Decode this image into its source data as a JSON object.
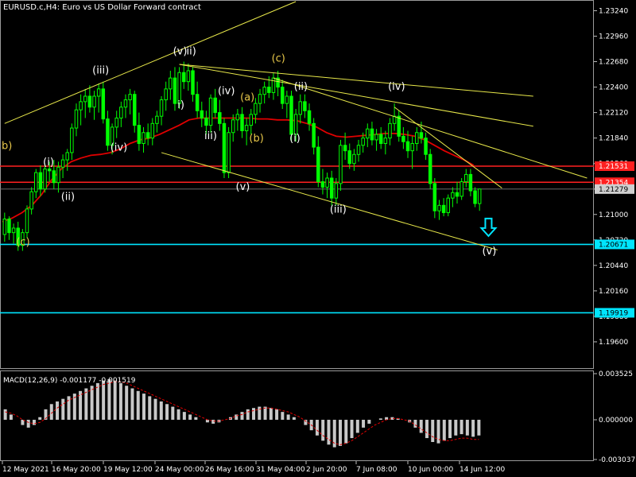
{
  "header": {
    "title": "EURUSD.c,H4:  Euro vs US Dollar Forward contract"
  },
  "chart_data": {
    "type": "candlestick",
    "main_panel": {
      "symbol": "EURUSD.c",
      "timeframe": "H4",
      "ylim": [
        1.1932,
        1.2334
      ],
      "y_ticks": [
        "1.23240",
        "1.22960",
        "1.22680",
        "1.22400",
        "1.22120",
        "1.21840",
        "1.21560",
        "1.21279",
        "1.21000",
        "1.20720",
        "1.20440",
        "1.20160",
        "1.19880",
        "1.19600"
      ],
      "y_tick_values": [
        1.2324,
        1.2296,
        1.2268,
        1.224,
        1.2212,
        1.2184,
        1.2156,
        1.21279,
        1.21,
        1.2072,
        1.2044,
        1.2016,
        1.1988,
        1.196
      ],
      "current_price": 1.21279,
      "moving_average_color": "#e00000",
      "candle_color": "#00ff00",
      "horizontal_levels": [
        {
          "value": 1.21531,
          "label": "1.21531",
          "color": "#ff2020"
        },
        {
          "value": 1.21354,
          "label": "1.21354",
          "color": "#ff2020"
        },
        {
          "value": 1.20671,
          "label": "1.20671",
          "color": "#00e5ff"
        },
        {
          "value": 1.19919,
          "label": "1.19919",
          "color": "#00e5ff"
        }
      ],
      "wave_labels": [
        {
          "text": "b)",
          "x": 0,
          "y": 1.2172,
          "color": "#e8c84a"
        },
        {
          "text": "(i)",
          "x": 10,
          "y": 1.2154,
          "color": "#ffffff"
        },
        {
          "text": "(ii)",
          "x": 14,
          "y": 1.2116,
          "color": "#ffffff"
        },
        {
          "text": "(c)",
          "x": 4,
          "y": 1.2066,
          "color": "#e8c84a"
        },
        {
          "text": "(iii)",
          "x": 21,
          "y": 1.2255,
          "color": "#ffffff"
        },
        {
          "text": "(iv)",
          "x": 25,
          "y": 1.217,
          "color": "#ffffff"
        },
        {
          "text": "(v)",
          "x": 39,
          "y": 1.2276,
          "color": "#ffffff"
        },
        {
          "text": "ii)",
          "x": 42,
          "y": 1.2276,
          "color": "#ffffff"
        },
        {
          "text": "i)",
          "x": 40,
          "y": 1.2217,
          "color": "#ffffff"
        },
        {
          "text": "(iv)",
          "x": 49,
          "y": 1.2232,
          "color": "#ffffff"
        },
        {
          "text": "iii)",
          "x": 46,
          "y": 1.2183,
          "color": "#ffffff"
        },
        {
          "text": "(a)",
          "x": 54,
          "y": 1.2225,
          "color": "#e8c84a"
        },
        {
          "text": "(b)",
          "x": 56,
          "y": 1.218,
          "color": "#e8c84a"
        },
        {
          "text": "(v)",
          "x": 53,
          "y": 1.2127,
          "color": "#ffffff"
        },
        {
          "text": "(c)",
          "x": 61,
          "y": 1.2268,
          "color": "#e8c84a"
        },
        {
          "text": "(ii)",
          "x": 66,
          "y": 1.2237,
          "color": "#ffffff"
        },
        {
          "text": "(i)",
          "x": 65,
          "y": 1.218,
          "color": "#ffffff"
        },
        {
          "text": "(iii)",
          "x": 74,
          "y": 1.2102,
          "color": "#ffffff"
        },
        {
          "text": "(iv)",
          "x": 87,
          "y": 1.2237,
          "color": "#ffffff"
        },
        {
          "text": "(v)",
          "x": 108,
          "y": 1.2056,
          "color": "#ffffff"
        }
      ],
      "trend_lines": [
        {
          "from": [
            0,
            1.22
          ],
          "to": [
            65,
            1.2334
          ],
          "color": "#e8e84a"
        },
        {
          "from": [
            35,
            1.2168
          ],
          "to": [
            110,
            1.2061
          ],
          "color": "#e8e84a"
        },
        {
          "from": [
            39,
            1.2265
          ],
          "to": [
            118,
            1.223
          ],
          "color": "#e8e84a"
        },
        {
          "from": [
            39,
            1.2265
          ],
          "to": [
            118,
            1.2197
          ],
          "color": "#e8e84a"
        },
        {
          "from": [
            60,
            1.225
          ],
          "to": [
            130,
            1.214
          ],
          "color": "#e8e84a"
        },
        {
          "from": [
            87,
            1.2218
          ],
          "to": [
            111,
            1.2129
          ],
          "color": "#e8e84a"
        }
      ],
      "arrow": {
        "x": 108,
        "y": 1.2085,
        "direction": "down",
        "color": "#00e5ff"
      }
    },
    "macd_panel": {
      "label": "MACD(12,26,9) -0.001177 -0.001519",
      "y_ticks": [
        "0.003525",
        "0.000000",
        "-0.003037"
      ],
      "y_tick_values": [
        0.003525,
        0.0,
        -0.003037
      ],
      "histogram_color": "#c8c8c8",
      "signal_color": "#e00000"
    },
    "x_ticks": [
      "12 May 2021",
      "16 May 20:00",
      "19 May 12:00",
      "24 May 00:00",
      "26 May 16:00",
      "31 May 04:00",
      "2 Jun 20:00",
      "7 Jun 08:00",
      "10 Jun 00:00",
      "14 Jun 12:00"
    ],
    "candles": [
      [
        1.2078,
        1.2102,
        1.207,
        1.2095
      ],
      [
        1.2095,
        1.2098,
        1.2072,
        1.208
      ],
      [
        1.208,
        1.209,
        1.2068,
        1.2085
      ],
      [
        1.2085,
        1.2092,
        1.206,
        1.2066
      ],
      [
        1.2066,
        1.2084,
        1.206,
        1.208
      ],
      [
        1.208,
        1.211,
        1.2074,
        1.2106
      ],
      [
        1.2106,
        1.213,
        1.21,
        1.2125
      ],
      [
        1.2125,
        1.215,
        1.2118,
        1.2146
      ],
      [
        1.2146,
        1.2154,
        1.212,
        1.2128
      ],
      [
        1.2128,
        1.2156,
        1.2124,
        1.215
      ],
      [
        1.215,
        1.2158,
        1.2136,
        1.2148
      ],
      [
        1.2148,
        1.216,
        1.2128,
        1.2135
      ],
      [
        1.2135,
        1.2158,
        1.2124,
        1.2152
      ],
      [
        1.2152,
        1.2166,
        1.214,
        1.216
      ],
      [
        1.216,
        1.2172,
        1.2148,
        1.2168
      ],
      [
        1.2168,
        1.22,
        1.216,
        1.2195
      ],
      [
        1.2195,
        1.2222,
        1.2186,
        1.2215
      ],
      [
        1.2215,
        1.2232,
        1.2198,
        1.2224
      ],
      [
        1.2224,
        1.2238,
        1.2206,
        1.223
      ],
      [
        1.223,
        1.2242,
        1.2212,
        1.2218
      ],
      [
        1.2218,
        1.2236,
        1.2204,
        1.223
      ],
      [
        1.223,
        1.2244,
        1.2212,
        1.2238
      ],
      [
        1.2238,
        1.2246,
        1.22,
        1.2205
      ],
      [
        1.2205,
        1.2214,
        1.217,
        1.2176
      ],
      [
        1.2176,
        1.22,
        1.2166,
        1.2196
      ],
      [
        1.2196,
        1.2214,
        1.2184,
        1.2206
      ],
      [
        1.2206,
        1.2224,
        1.2196,
        1.2218
      ],
      [
        1.2218,
        1.2232,
        1.2206,
        1.2226
      ],
      [
        1.2226,
        1.2238,
        1.221,
        1.2232
      ],
      [
        1.2232,
        1.2236,
        1.219,
        1.2198
      ],
      [
        1.2198,
        1.2212,
        1.217,
        1.2178
      ],
      [
        1.2178,
        1.2196,
        1.2168,
        1.219
      ],
      [
        1.219,
        1.22,
        1.2176,
        1.2184
      ],
      [
        1.2184,
        1.2206,
        1.2176,
        1.22
      ],
      [
        1.22,
        1.2214,
        1.219,
        1.2208
      ],
      [
        1.2208,
        1.223,
        1.2198,
        1.2226
      ],
      [
        1.2226,
        1.2246,
        1.2214,
        1.2238
      ],
      [
        1.2238,
        1.2258,
        1.2226,
        1.225
      ],
      [
        1.225,
        1.2262,
        1.2214,
        1.2222
      ],
      [
        1.2222,
        1.2262,
        1.2216,
        1.2256
      ],
      [
        1.2256,
        1.2268,
        1.2238,
        1.2246
      ],
      [
        1.2246,
        1.2266,
        1.2236,
        1.2258
      ],
      [
        1.2258,
        1.2262,
        1.2224,
        1.2232
      ],
      [
        1.2232,
        1.2246,
        1.2206,
        1.2214
      ],
      [
        1.2214,
        1.2224,
        1.2196,
        1.2206
      ],
      [
        1.2206,
        1.2214,
        1.2188,
        1.2198
      ],
      [
        1.2198,
        1.2232,
        1.219,
        1.2228
      ],
      [
        1.2228,
        1.2238,
        1.2206,
        1.2212
      ],
      [
        1.2212,
        1.2226,
        1.2192,
        1.22
      ],
      [
        1.22,
        1.2206,
        1.214,
        1.2146
      ],
      [
        1.2146,
        1.2196,
        1.214,
        1.219
      ],
      [
        1.219,
        1.221,
        1.218,
        1.2204
      ],
      [
        1.2204,
        1.2216,
        1.2192,
        1.221
      ],
      [
        1.221,
        1.2218,
        1.2184,
        1.2192
      ],
      [
        1.2192,
        1.2206,
        1.2176,
        1.2198
      ],
      [
        1.2198,
        1.2216,
        1.2188,
        1.221
      ],
      [
        1.221,
        1.2228,
        1.22,
        1.2222
      ],
      [
        1.2222,
        1.2238,
        1.2212,
        1.2232
      ],
      [
        1.2232,
        1.2246,
        1.2222,
        1.224
      ],
      [
        1.224,
        1.2252,
        1.2228,
        1.2234
      ],
      [
        1.2234,
        1.2256,
        1.2226,
        1.225
      ],
      [
        1.225,
        1.2258,
        1.223,
        1.224
      ],
      [
        1.224,
        1.2248,
        1.2216,
        1.2222
      ],
      [
        1.2222,
        1.2236,
        1.2206,
        1.223
      ],
      [
        1.223,
        1.2236,
        1.218,
        1.2188
      ],
      [
        1.2188,
        1.2216,
        1.218,
        1.221
      ],
      [
        1.221,
        1.2232,
        1.22,
        1.2224
      ],
      [
        1.2224,
        1.2232,
        1.2206,
        1.2214
      ],
      [
        1.2214,
        1.2222,
        1.2192,
        1.22
      ],
      [
        1.22,
        1.2206,
        1.2166,
        1.2174
      ],
      [
        1.2174,
        1.2186,
        1.213,
        1.2136
      ],
      [
        1.2136,
        1.215,
        1.2122,
        1.213
      ],
      [
        1.213,
        1.2146,
        1.2118,
        1.214
      ],
      [
        1.214,
        1.2148,
        1.211,
        1.2118
      ],
      [
        1.2118,
        1.214,
        1.211,
        1.2134
      ],
      [
        1.2134,
        1.2182,
        1.2126,
        1.2176
      ],
      [
        1.2176,
        1.219,
        1.216,
        1.217
      ],
      [
        1.217,
        1.2178,
        1.215,
        1.2156
      ],
      [
        1.2156,
        1.2172,
        1.2148,
        1.2166
      ],
      [
        1.2166,
        1.2182,
        1.2158,
        1.2176
      ],
      [
        1.2176,
        1.219,
        1.2168,
        1.2184
      ],
      [
        1.2184,
        1.22,
        1.2174,
        1.2194
      ],
      [
        1.2194,
        1.2202,
        1.2176,
        1.2182
      ],
      [
        1.2182,
        1.2194,
        1.217,
        1.2188
      ],
      [
        1.2188,
        1.2196,
        1.2172,
        1.2178
      ],
      [
        1.2178,
        1.2192,
        1.2166,
        1.2184
      ],
      [
        1.2184,
        1.2206,
        1.2176,
        1.22
      ],
      [
        1.22,
        1.2222,
        1.2192,
        1.2208
      ],
      [
        1.2208,
        1.2214,
        1.218,
        1.2186
      ],
      [
        1.2186,
        1.2196,
        1.2172,
        1.218
      ],
      [
        1.218,
        1.2192,
        1.2162,
        1.217
      ],
      [
        1.217,
        1.2186,
        1.215,
        1.2178
      ],
      [
        1.2178,
        1.2196,
        1.217,
        1.219
      ],
      [
        1.219,
        1.2202,
        1.2178,
        1.2184
      ],
      [
        1.2184,
        1.219,
        1.216,
        1.2166
      ],
      [
        1.2166,
        1.2172,
        1.2128,
        1.2134
      ],
      [
        1.2134,
        1.214,
        1.2096,
        1.2104
      ],
      [
        1.2104,
        1.2116,
        1.2094,
        1.211
      ],
      [
        1.211,
        1.2118,
        1.2098,
        1.2102
      ],
      [
        1.2102,
        1.2122,
        1.2098,
        1.2118
      ],
      [
        1.2118,
        1.213,
        1.2108,
        1.2124
      ],
      [
        1.2124,
        1.2136,
        1.2112,
        1.212
      ],
      [
        1.212,
        1.214,
        1.2116,
        1.2136
      ],
      [
        1.2136,
        1.215,
        1.213,
        1.2144
      ],
      [
        1.2144,
        1.215,
        1.212,
        1.2126
      ],
      [
        1.2126,
        1.213,
        1.2108,
        1.2112
      ],
      [
        1.2112,
        1.2124,
        1.2104,
        1.2128
      ]
    ],
    "moving_average": [
      1.2092,
      1.2096,
      1.2102,
      1.211,
      1.2122,
      1.2138,
      1.215,
      1.2158,
      1.2162,
      1.2165,
      1.2166,
      1.2168,
      1.2172,
      1.2178,
      1.2182,
      1.2184,
      1.2188,
      1.2193,
      1.2198,
      1.2204,
      1.2206,
      1.2206,
      1.2206,
      1.2206,
      1.2206,
      1.2206,
      1.2205,
      1.2205,
      1.2204,
      1.2204,
      1.2203,
      1.22,
      1.2196,
      1.219,
      1.2186,
      1.2185,
      1.2186,
      1.2187,
      1.2188,
      1.2189,
      1.2189,
      1.2188,
      1.2186,
      1.2182,
      1.2176,
      1.217,
      1.2165,
      1.216,
      1.2154
    ],
    "macd_histogram": [
      0.0008,
      0.0004,
      0.0,
      -0.0004,
      -0.0006,
      -0.0004,
      0.0002,
      0.0008,
      0.0012,
      0.0014,
      0.0016,
      0.0018,
      0.002,
      0.0022,
      0.0024,
      0.0026,
      0.0028,
      0.003,
      0.0031,
      0.003,
      0.0028,
      0.0026,
      0.0024,
      0.0022,
      0.002,
      0.0018,
      0.0016,
      0.0014,
      0.0012,
      0.001,
      0.0008,
      0.0006,
      0.0004,
      0.0002,
      0.0,
      -0.0002,
      -0.0003,
      -0.0002,
      0.0,
      0.0002,
      0.0004,
      0.0006,
      0.0008,
      0.0009,
      0.001,
      0.001,
      0.0009,
      0.0008,
      0.0006,
      0.0004,
      0.0002,
      0.0,
      -0.0004,
      -0.0008,
      -0.0012,
      -0.0016,
      -0.0019,
      -0.0021,
      -0.002,
      -0.0018,
      -0.0014,
      -0.001,
      -0.0006,
      -0.0003,
      0.0,
      0.0001,
      0.0002,
      0.0002,
      0.0001,
      0.0,
      -0.0002,
      -0.0006,
      -0.001,
      -0.0014,
      -0.0017,
      -0.0018,
      -0.0016,
      -0.0014,
      -0.0012,
      -0.0011,
      -0.0012,
      -0.0013,
      -0.0012
    ],
    "macd_signal": [
      0.0006,
      0.0005,
      0.0003,
      0.0,
      -0.0002,
      -0.0003,
      -0.0002,
      0.0001,
      0.0005,
      0.0009,
      0.0012,
      0.0015,
      0.0017,
      0.0019,
      0.0021,
      0.0023,
      0.0025,
      0.0027,
      0.0028,
      0.0029,
      0.0029,
      0.0028,
      0.0026,
      0.0024,
      0.0022,
      0.002,
      0.0018,
      0.0016,
      0.0014,
      0.0012,
      0.001,
      0.0008,
      0.0006,
      0.0004,
      0.0002,
      0.0,
      -0.0001,
      -0.0001,
      0.0,
      0.0001,
      0.0003,
      0.0004,
      0.0006,
      0.0007,
      0.0008,
      0.0009,
      0.0009,
      0.0008,
      0.0007,
      0.0006,
      0.0004,
      0.0002,
      -0.0001,
      -0.0004,
      -0.0008,
      -0.0012,
      -0.0015,
      -0.0018,
      -0.0019,
      -0.0018,
      -0.0016,
      -0.0013,
      -0.001,
      -0.0007,
      -0.0004,
      -0.0002,
      0.0,
      0.0001,
      0.0001,
      0.0,
      -0.0001,
      -0.0004,
      -0.0007,
      -0.001,
      -0.0013,
      -0.0015,
      -0.0016,
      -0.0016,
      -0.0015,
      -0.0014,
      -0.0014,
      -0.0015,
      -0.0015
    ]
  }
}
